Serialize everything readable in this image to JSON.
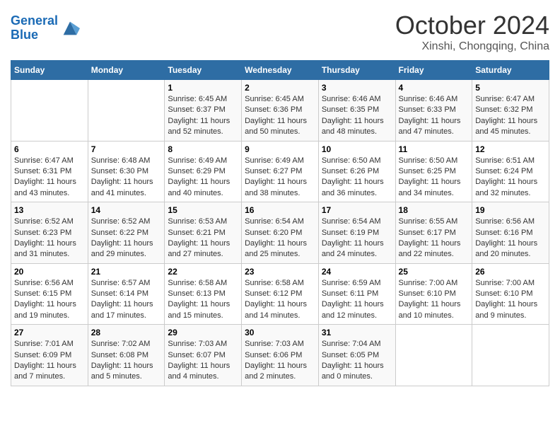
{
  "header": {
    "logo_line1": "General",
    "logo_line2": "Blue",
    "month_title": "October 2024",
    "location": "Xinshi, Chongqing, China"
  },
  "weekdays": [
    "Sunday",
    "Monday",
    "Tuesday",
    "Wednesday",
    "Thursday",
    "Friday",
    "Saturday"
  ],
  "weeks": [
    [
      {
        "day": "",
        "sunrise": "",
        "sunset": "",
        "daylight": ""
      },
      {
        "day": "",
        "sunrise": "",
        "sunset": "",
        "daylight": ""
      },
      {
        "day": "1",
        "sunrise": "Sunrise: 6:45 AM",
        "sunset": "Sunset: 6:37 PM",
        "daylight": "Daylight: 11 hours and 52 minutes."
      },
      {
        "day": "2",
        "sunrise": "Sunrise: 6:45 AM",
        "sunset": "Sunset: 6:36 PM",
        "daylight": "Daylight: 11 hours and 50 minutes."
      },
      {
        "day": "3",
        "sunrise": "Sunrise: 6:46 AM",
        "sunset": "Sunset: 6:35 PM",
        "daylight": "Daylight: 11 hours and 48 minutes."
      },
      {
        "day": "4",
        "sunrise": "Sunrise: 6:46 AM",
        "sunset": "Sunset: 6:33 PM",
        "daylight": "Daylight: 11 hours and 47 minutes."
      },
      {
        "day": "5",
        "sunrise": "Sunrise: 6:47 AM",
        "sunset": "Sunset: 6:32 PM",
        "daylight": "Daylight: 11 hours and 45 minutes."
      }
    ],
    [
      {
        "day": "6",
        "sunrise": "Sunrise: 6:47 AM",
        "sunset": "Sunset: 6:31 PM",
        "daylight": "Daylight: 11 hours and 43 minutes."
      },
      {
        "day": "7",
        "sunrise": "Sunrise: 6:48 AM",
        "sunset": "Sunset: 6:30 PM",
        "daylight": "Daylight: 11 hours and 41 minutes."
      },
      {
        "day": "8",
        "sunrise": "Sunrise: 6:49 AM",
        "sunset": "Sunset: 6:29 PM",
        "daylight": "Daylight: 11 hours and 40 minutes."
      },
      {
        "day": "9",
        "sunrise": "Sunrise: 6:49 AM",
        "sunset": "Sunset: 6:27 PM",
        "daylight": "Daylight: 11 hours and 38 minutes."
      },
      {
        "day": "10",
        "sunrise": "Sunrise: 6:50 AM",
        "sunset": "Sunset: 6:26 PM",
        "daylight": "Daylight: 11 hours and 36 minutes."
      },
      {
        "day": "11",
        "sunrise": "Sunrise: 6:50 AM",
        "sunset": "Sunset: 6:25 PM",
        "daylight": "Daylight: 11 hours and 34 minutes."
      },
      {
        "day": "12",
        "sunrise": "Sunrise: 6:51 AM",
        "sunset": "Sunset: 6:24 PM",
        "daylight": "Daylight: 11 hours and 32 minutes."
      }
    ],
    [
      {
        "day": "13",
        "sunrise": "Sunrise: 6:52 AM",
        "sunset": "Sunset: 6:23 PM",
        "daylight": "Daylight: 11 hours and 31 minutes."
      },
      {
        "day": "14",
        "sunrise": "Sunrise: 6:52 AM",
        "sunset": "Sunset: 6:22 PM",
        "daylight": "Daylight: 11 hours and 29 minutes."
      },
      {
        "day": "15",
        "sunrise": "Sunrise: 6:53 AM",
        "sunset": "Sunset: 6:21 PM",
        "daylight": "Daylight: 11 hours and 27 minutes."
      },
      {
        "day": "16",
        "sunrise": "Sunrise: 6:54 AM",
        "sunset": "Sunset: 6:20 PM",
        "daylight": "Daylight: 11 hours and 25 minutes."
      },
      {
        "day": "17",
        "sunrise": "Sunrise: 6:54 AM",
        "sunset": "Sunset: 6:19 PM",
        "daylight": "Daylight: 11 hours and 24 minutes."
      },
      {
        "day": "18",
        "sunrise": "Sunrise: 6:55 AM",
        "sunset": "Sunset: 6:17 PM",
        "daylight": "Daylight: 11 hours and 22 minutes."
      },
      {
        "day": "19",
        "sunrise": "Sunrise: 6:56 AM",
        "sunset": "Sunset: 6:16 PM",
        "daylight": "Daylight: 11 hours and 20 minutes."
      }
    ],
    [
      {
        "day": "20",
        "sunrise": "Sunrise: 6:56 AM",
        "sunset": "Sunset: 6:15 PM",
        "daylight": "Daylight: 11 hours and 19 minutes."
      },
      {
        "day": "21",
        "sunrise": "Sunrise: 6:57 AM",
        "sunset": "Sunset: 6:14 PM",
        "daylight": "Daylight: 11 hours and 17 minutes."
      },
      {
        "day": "22",
        "sunrise": "Sunrise: 6:58 AM",
        "sunset": "Sunset: 6:13 PM",
        "daylight": "Daylight: 11 hours and 15 minutes."
      },
      {
        "day": "23",
        "sunrise": "Sunrise: 6:58 AM",
        "sunset": "Sunset: 6:12 PM",
        "daylight": "Daylight: 11 hours and 14 minutes."
      },
      {
        "day": "24",
        "sunrise": "Sunrise: 6:59 AM",
        "sunset": "Sunset: 6:11 PM",
        "daylight": "Daylight: 11 hours and 12 minutes."
      },
      {
        "day": "25",
        "sunrise": "Sunrise: 7:00 AM",
        "sunset": "Sunset: 6:10 PM",
        "daylight": "Daylight: 11 hours and 10 minutes."
      },
      {
        "day": "26",
        "sunrise": "Sunrise: 7:00 AM",
        "sunset": "Sunset: 6:10 PM",
        "daylight": "Daylight: 11 hours and 9 minutes."
      }
    ],
    [
      {
        "day": "27",
        "sunrise": "Sunrise: 7:01 AM",
        "sunset": "Sunset: 6:09 PM",
        "daylight": "Daylight: 11 hours and 7 minutes."
      },
      {
        "day": "28",
        "sunrise": "Sunrise: 7:02 AM",
        "sunset": "Sunset: 6:08 PM",
        "daylight": "Daylight: 11 hours and 5 minutes."
      },
      {
        "day": "29",
        "sunrise": "Sunrise: 7:03 AM",
        "sunset": "Sunset: 6:07 PM",
        "daylight": "Daylight: 11 hours and 4 minutes."
      },
      {
        "day": "30",
        "sunrise": "Sunrise: 7:03 AM",
        "sunset": "Sunset: 6:06 PM",
        "daylight": "Daylight: 11 hours and 2 minutes."
      },
      {
        "day": "31",
        "sunrise": "Sunrise: 7:04 AM",
        "sunset": "Sunset: 6:05 PM",
        "daylight": "Daylight: 11 hours and 0 minutes."
      },
      {
        "day": "",
        "sunrise": "",
        "sunset": "",
        "daylight": ""
      },
      {
        "day": "",
        "sunrise": "",
        "sunset": "",
        "daylight": ""
      }
    ]
  ]
}
